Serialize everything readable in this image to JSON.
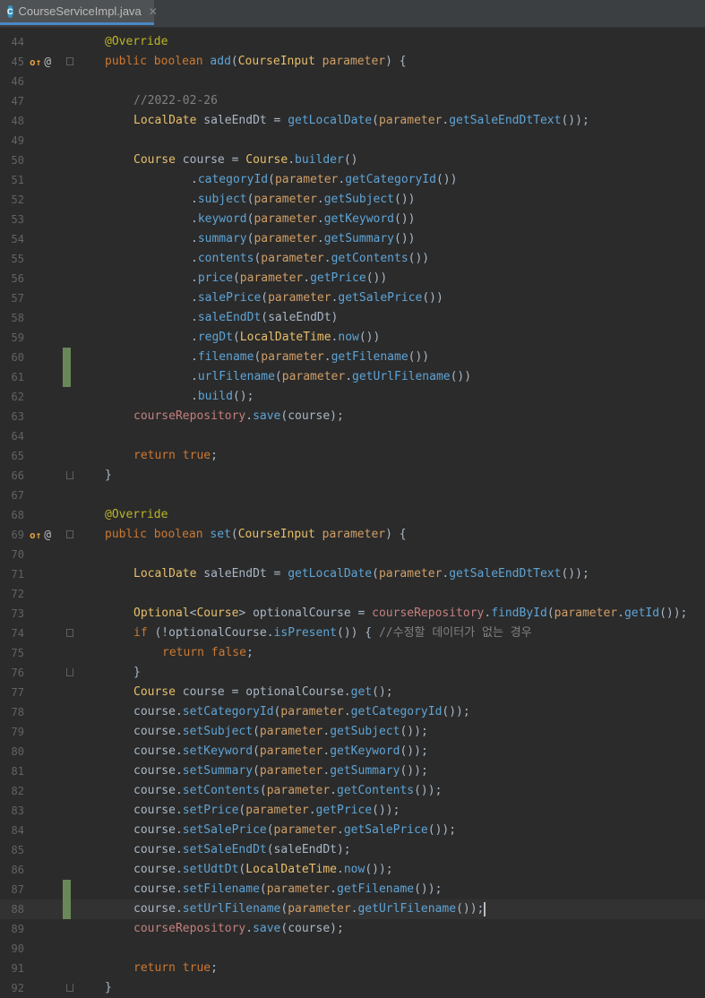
{
  "tab": {
    "label": "CourseServiceImpl.java",
    "icon_letter": "C",
    "close": "✕"
  },
  "gutter": {
    "override_marker": "o↑",
    "annotation_marker": "@"
  },
  "caret_line": 88,
  "lines": [
    {
      "n": "44",
      "indent": 0,
      "toks": [
        [
          "ann",
          "@Override"
        ]
      ]
    },
    {
      "n": "45",
      "indent": 0,
      "gutter": true,
      "fold": "start",
      "toks": [
        [
          "kw",
          "public "
        ],
        [
          "kw",
          "boolean "
        ],
        [
          "call",
          "add"
        ],
        [
          "",
          "("
        ],
        [
          "type",
          "CourseInput "
        ],
        [
          "param",
          "parameter"
        ],
        [
          "",
          ") {"
        ]
      ]
    },
    {
      "n": "46",
      "indent": 0,
      "toks": []
    },
    {
      "n": "47",
      "indent": 1,
      "toks": [
        [
          "comment",
          "//2022-02-26"
        ]
      ]
    },
    {
      "n": "48",
      "indent": 1,
      "toks": [
        [
          "type",
          "LocalDate "
        ],
        [
          "",
          "saleEndDt = "
        ],
        [
          "call",
          "getLocalDate"
        ],
        [
          "",
          "("
        ],
        [
          "param",
          "parameter"
        ],
        [
          "",
          "."
        ],
        [
          "call",
          "getSaleEndDtText"
        ],
        [
          "",
          "());"
        ]
      ]
    },
    {
      "n": "49",
      "indent": 0,
      "toks": []
    },
    {
      "n": "50",
      "indent": 1,
      "toks": [
        [
          "type",
          "Course "
        ],
        [
          "",
          "course = "
        ],
        [
          "type",
          "Course"
        ],
        [
          "",
          "."
        ],
        [
          "call",
          "builder"
        ],
        [
          "",
          "()"
        ]
      ]
    },
    {
      "n": "51",
      "indent": 3,
      "toks": [
        [
          "",
          "."
        ],
        [
          "call",
          "categoryId"
        ],
        [
          "",
          "("
        ],
        [
          "param",
          "parameter"
        ],
        [
          "",
          "."
        ],
        [
          "call",
          "getCategoryId"
        ],
        [
          "",
          "())"
        ]
      ]
    },
    {
      "n": "52",
      "indent": 3,
      "toks": [
        [
          "",
          "."
        ],
        [
          "call",
          "subject"
        ],
        [
          "",
          "("
        ],
        [
          "param",
          "parameter"
        ],
        [
          "",
          "."
        ],
        [
          "call",
          "getSubject"
        ],
        [
          "",
          "())"
        ]
      ]
    },
    {
      "n": "53",
      "indent": 3,
      "toks": [
        [
          "",
          "."
        ],
        [
          "call",
          "keyword"
        ],
        [
          "",
          "("
        ],
        [
          "param",
          "parameter"
        ],
        [
          "",
          "."
        ],
        [
          "call",
          "getKeyword"
        ],
        [
          "",
          "())"
        ]
      ]
    },
    {
      "n": "54",
      "indent": 3,
      "toks": [
        [
          "",
          "."
        ],
        [
          "call",
          "summary"
        ],
        [
          "",
          "("
        ],
        [
          "param",
          "parameter"
        ],
        [
          "",
          "."
        ],
        [
          "call",
          "getSummary"
        ],
        [
          "",
          "())"
        ]
      ]
    },
    {
      "n": "55",
      "indent": 3,
      "toks": [
        [
          "",
          "."
        ],
        [
          "call",
          "contents"
        ],
        [
          "",
          "("
        ],
        [
          "param",
          "parameter"
        ],
        [
          "",
          "."
        ],
        [
          "call",
          "getContents"
        ],
        [
          "",
          "())"
        ]
      ]
    },
    {
      "n": "56",
      "indent": 3,
      "toks": [
        [
          "",
          "."
        ],
        [
          "call",
          "price"
        ],
        [
          "",
          "("
        ],
        [
          "param",
          "parameter"
        ],
        [
          "",
          "."
        ],
        [
          "call",
          "getPrice"
        ],
        [
          "",
          "())"
        ]
      ]
    },
    {
      "n": "57",
      "indent": 3,
      "toks": [
        [
          "",
          "."
        ],
        [
          "call",
          "salePrice"
        ],
        [
          "",
          "("
        ],
        [
          "param",
          "parameter"
        ],
        [
          "",
          "."
        ],
        [
          "call",
          "getSalePrice"
        ],
        [
          "",
          "())"
        ]
      ]
    },
    {
      "n": "58",
      "indent": 3,
      "toks": [
        [
          "",
          "."
        ],
        [
          "call",
          "saleEndDt"
        ],
        [
          "",
          "(saleEndDt)"
        ]
      ]
    },
    {
      "n": "59",
      "indent": 3,
      "toks": [
        [
          "",
          "."
        ],
        [
          "call",
          "regDt"
        ],
        [
          "",
          "("
        ],
        [
          "type",
          "LocalDateTime"
        ],
        [
          "",
          "."
        ],
        [
          "call",
          "now"
        ],
        [
          "",
          "())"
        ]
      ]
    },
    {
      "n": "60",
      "indent": 3,
      "change": true,
      "toks": [
        [
          "",
          "."
        ],
        [
          "call",
          "filename"
        ],
        [
          "",
          "("
        ],
        [
          "param",
          "parameter"
        ],
        [
          "",
          "."
        ],
        [
          "call",
          "getFilename"
        ],
        [
          "",
          "())"
        ]
      ]
    },
    {
      "n": "61",
      "indent": 3,
      "change": true,
      "toks": [
        [
          "",
          "."
        ],
        [
          "call",
          "urlFilename"
        ],
        [
          "",
          "("
        ],
        [
          "param",
          "parameter"
        ],
        [
          "",
          "."
        ],
        [
          "call",
          "getUrlFilename"
        ],
        [
          "",
          "())"
        ]
      ]
    },
    {
      "n": "62",
      "indent": 3,
      "toks": [
        [
          "",
          "."
        ],
        [
          "call",
          "build"
        ],
        [
          "",
          "();"
        ]
      ]
    },
    {
      "n": "63",
      "indent": 1,
      "toks": [
        [
          "field",
          "courseRepository"
        ],
        [
          "",
          "."
        ],
        [
          "call",
          "save"
        ],
        [
          "",
          "(course);"
        ]
      ]
    },
    {
      "n": "64",
      "indent": 0,
      "toks": []
    },
    {
      "n": "65",
      "indent": 1,
      "toks": [
        [
          "kw",
          "return "
        ],
        [
          "kw",
          "true"
        ],
        [
          "",
          ";"
        ]
      ]
    },
    {
      "n": "66",
      "indent": 0,
      "fold": "end",
      "toks": [
        [
          "",
          "}"
        ]
      ]
    },
    {
      "n": "67",
      "indent": 0,
      "toks": []
    },
    {
      "n": "68",
      "indent": 0,
      "toks": [
        [
          "ann",
          "@Override"
        ]
      ]
    },
    {
      "n": "69",
      "indent": 0,
      "gutter": true,
      "fold": "start",
      "toks": [
        [
          "kw",
          "public "
        ],
        [
          "kw",
          "boolean "
        ],
        [
          "call",
          "set"
        ],
        [
          "",
          "("
        ],
        [
          "type",
          "CourseInput "
        ],
        [
          "param",
          "parameter"
        ],
        [
          "",
          ") {"
        ]
      ]
    },
    {
      "n": "70",
      "indent": 0,
      "toks": []
    },
    {
      "n": "71",
      "indent": 1,
      "toks": [
        [
          "type",
          "LocalDate "
        ],
        [
          "",
          "saleEndDt = "
        ],
        [
          "call",
          "getLocalDate"
        ],
        [
          "",
          "("
        ],
        [
          "param",
          "parameter"
        ],
        [
          "",
          "."
        ],
        [
          "call",
          "getSaleEndDtText"
        ],
        [
          "",
          "());"
        ]
      ]
    },
    {
      "n": "72",
      "indent": 0,
      "toks": []
    },
    {
      "n": "73",
      "indent": 1,
      "toks": [
        [
          "type",
          "Optional"
        ],
        [
          "",
          "<"
        ],
        [
          "type",
          "Course"
        ],
        [
          "",
          "> optionalCourse = "
        ],
        [
          "field",
          "courseRepository"
        ],
        [
          "",
          "."
        ],
        [
          "call",
          "findById"
        ],
        [
          "",
          "("
        ],
        [
          "param",
          "parameter"
        ],
        [
          "",
          "."
        ],
        [
          "call",
          "getId"
        ],
        [
          "",
          "());"
        ]
      ]
    },
    {
      "n": "74",
      "indent": 1,
      "fold": "start",
      "toks": [
        [
          "kw",
          "if "
        ],
        [
          "",
          "(!optionalCourse."
        ],
        [
          "call",
          "isPresent"
        ],
        [
          "",
          "()) { "
        ],
        [
          "comment",
          "//수정할 데이터가 없는 경우"
        ]
      ]
    },
    {
      "n": "75",
      "indent": 2,
      "toks": [
        [
          "kw",
          "return "
        ],
        [
          "kw",
          "false"
        ],
        [
          "",
          ";"
        ]
      ]
    },
    {
      "n": "76",
      "indent": 1,
      "fold": "end",
      "toks": [
        [
          "",
          "}"
        ]
      ]
    },
    {
      "n": "77",
      "indent": 1,
      "toks": [
        [
          "type",
          "Course "
        ],
        [
          "",
          "course = optionalCourse."
        ],
        [
          "call",
          "get"
        ],
        [
          "",
          "();"
        ]
      ]
    },
    {
      "n": "78",
      "indent": 1,
      "toks": [
        [
          "",
          "course."
        ],
        [
          "call",
          "setCategoryId"
        ],
        [
          "",
          "("
        ],
        [
          "param",
          "parameter"
        ],
        [
          "",
          "."
        ],
        [
          "call",
          "getCategoryId"
        ],
        [
          "",
          "());"
        ]
      ]
    },
    {
      "n": "79",
      "indent": 1,
      "toks": [
        [
          "",
          "course."
        ],
        [
          "call",
          "setSubject"
        ],
        [
          "",
          "("
        ],
        [
          "param",
          "parameter"
        ],
        [
          "",
          "."
        ],
        [
          "call",
          "getSubject"
        ],
        [
          "",
          "());"
        ]
      ]
    },
    {
      "n": "80",
      "indent": 1,
      "toks": [
        [
          "",
          "course."
        ],
        [
          "call",
          "setKeyword"
        ],
        [
          "",
          "("
        ],
        [
          "param",
          "parameter"
        ],
        [
          "",
          "."
        ],
        [
          "call",
          "getKeyword"
        ],
        [
          "",
          "());"
        ]
      ]
    },
    {
      "n": "81",
      "indent": 1,
      "toks": [
        [
          "",
          "course."
        ],
        [
          "call",
          "setSummary"
        ],
        [
          "",
          "("
        ],
        [
          "param",
          "parameter"
        ],
        [
          "",
          "."
        ],
        [
          "call",
          "getSummary"
        ],
        [
          "",
          "());"
        ]
      ]
    },
    {
      "n": "82",
      "indent": 1,
      "toks": [
        [
          "",
          "course."
        ],
        [
          "call",
          "setContents"
        ],
        [
          "",
          "("
        ],
        [
          "param",
          "parameter"
        ],
        [
          "",
          "."
        ],
        [
          "call",
          "getContents"
        ],
        [
          "",
          "());"
        ]
      ]
    },
    {
      "n": "83",
      "indent": 1,
      "toks": [
        [
          "",
          "course."
        ],
        [
          "call",
          "setPrice"
        ],
        [
          "",
          "("
        ],
        [
          "param",
          "parameter"
        ],
        [
          "",
          "."
        ],
        [
          "call",
          "getPrice"
        ],
        [
          "",
          "());"
        ]
      ]
    },
    {
      "n": "84",
      "indent": 1,
      "toks": [
        [
          "",
          "course."
        ],
        [
          "call",
          "setSalePrice"
        ],
        [
          "",
          "("
        ],
        [
          "param",
          "parameter"
        ],
        [
          "",
          "."
        ],
        [
          "call",
          "getSalePrice"
        ],
        [
          "",
          "());"
        ]
      ]
    },
    {
      "n": "85",
      "indent": 1,
      "toks": [
        [
          "",
          "course."
        ],
        [
          "call",
          "setSaleEndDt"
        ],
        [
          "",
          "(saleEndDt);"
        ]
      ]
    },
    {
      "n": "86",
      "indent": 1,
      "toks": [
        [
          "",
          "course."
        ],
        [
          "call",
          "setUdtDt"
        ],
        [
          "",
          "("
        ],
        [
          "type",
          "LocalDateTime"
        ],
        [
          "",
          "."
        ],
        [
          "call",
          "now"
        ],
        [
          "",
          "());"
        ]
      ]
    },
    {
      "n": "87",
      "indent": 1,
      "change": true,
      "toks": [
        [
          "",
          "course."
        ],
        [
          "call",
          "setFilename"
        ],
        [
          "",
          "("
        ],
        [
          "param",
          "parameter"
        ],
        [
          "",
          "."
        ],
        [
          "call",
          "getFilename"
        ],
        [
          "",
          "());"
        ]
      ]
    },
    {
      "n": "88",
      "indent": 1,
      "change": true,
      "toks": [
        [
          "",
          "course."
        ],
        [
          "call",
          "setUrlFilename"
        ],
        [
          "",
          "("
        ],
        [
          "param",
          "parameter"
        ],
        [
          "",
          "."
        ],
        [
          "call",
          "getUrlFilename"
        ],
        [
          "",
          "());"
        ]
      ]
    },
    {
      "n": "89",
      "indent": 1,
      "toks": [
        [
          "field",
          "courseRepository"
        ],
        [
          "",
          "."
        ],
        [
          "call",
          "save"
        ],
        [
          "",
          "(course);"
        ]
      ]
    },
    {
      "n": "90",
      "indent": 0,
      "toks": []
    },
    {
      "n": "91",
      "indent": 1,
      "toks": [
        [
          "kw",
          "return "
        ],
        [
          "kw",
          "true"
        ],
        [
          "",
          ";"
        ]
      ]
    },
    {
      "n": "92",
      "indent": 0,
      "fold": "end",
      "toks": [
        [
          "",
          "}"
        ]
      ]
    }
  ]
}
